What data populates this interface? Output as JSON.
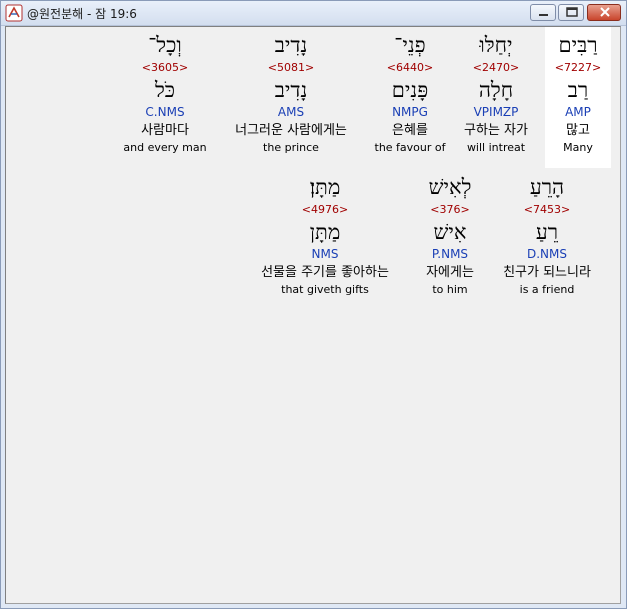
{
  "window": {
    "title": "@원전분해 - 잠 19:6",
    "colors": {
      "hebrew": "#000000",
      "strong": "#a00000",
      "morph": "#1a3fb5"
    }
  },
  "rows": [
    {
      "words": [
        {
          "hebrew": "וְכָל־",
          "strong": "<3605>",
          "root": "כֹּל",
          "morph": "C.NMS",
          "korean": "사람마다",
          "english": "and every man"
        },
        {
          "hebrew": "נָדִיב",
          "strong": "<5081>",
          "root": "נָדִיב",
          "morph": "AMS",
          "korean": "너그러운 사람에게는",
          "english": "the prince"
        },
        {
          "hebrew": "פְנֵי־",
          "strong": "<6440>",
          "root": "פָּנִים",
          "morph": "NMPG",
          "korean": "은혜를",
          "english": "the favour of"
        },
        {
          "hebrew": "יְחַלּוּ",
          "strong": "<2470>",
          "root": "חָלָה",
          "morph": "VPIMZP",
          "korean": "구하는 자가",
          "english": "will intreat"
        },
        {
          "hebrew": "רַבִּים",
          "strong": "<7227>",
          "root": "רַב",
          "morph": "AMP",
          "korean": "많고",
          "english": "Many"
        }
      ]
    },
    {
      "words": [
        {
          "hebrew": "מַתָּן׃",
          "strong": "<4976>",
          "root": "מַתָּן",
          "morph": "NMS",
          "korean": "선물을 주기를 좋아하는",
          "english": "that giveth gifts"
        },
        {
          "hebrew": "לְאִישׁ",
          "strong": "<376>",
          "root": "אִישׁ",
          "morph": "P.NMS",
          "korean": "자에게는",
          "english": "to him"
        },
        {
          "hebrew": "הָרֵעַ",
          "strong": "<7453>",
          "root": "רֵעַ",
          "morph": "D.NMS",
          "korean": "친구가 되느니라",
          "english": "is a friend"
        }
      ]
    }
  ]
}
